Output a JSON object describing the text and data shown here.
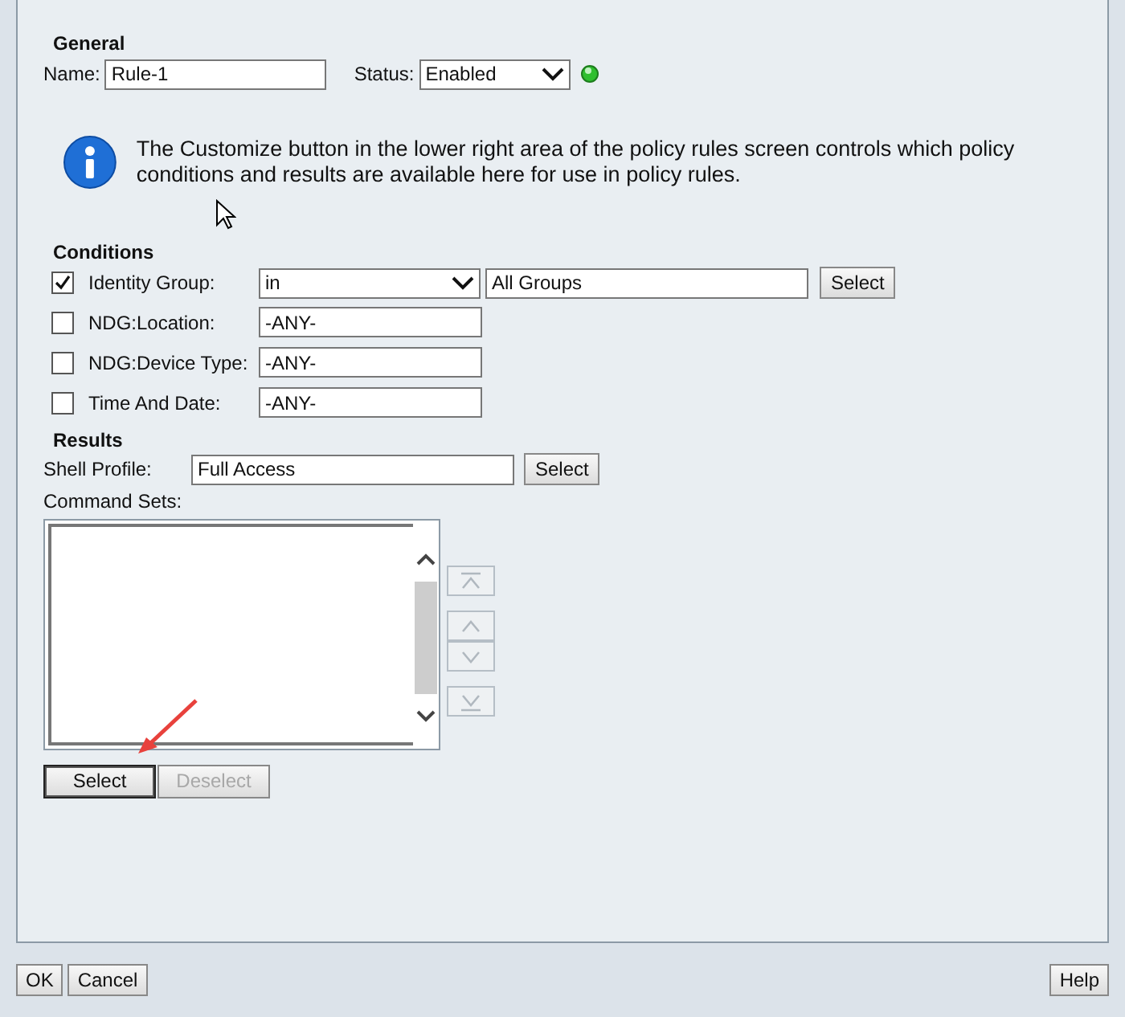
{
  "general": {
    "heading": "General",
    "name_label": "Name:",
    "name_value": "Rule-1",
    "status_label": "Status:",
    "status_value": "Enabled"
  },
  "info": {
    "text": "The Customize button in the lower right area of the policy rules screen controls which policy conditions and results are available here for use in policy rules."
  },
  "conditions": {
    "heading": "Conditions",
    "rows": [
      {
        "label": "Identity Group:",
        "checked": true,
        "kind": "select",
        "operator": "in",
        "value": "All Groups",
        "button": "Select"
      },
      {
        "label": "NDG:Location:",
        "checked": false,
        "kind": "field",
        "value": "-ANY-"
      },
      {
        "label": "NDG:Device Type:",
        "checked": false,
        "kind": "field",
        "value": "-ANY-"
      },
      {
        "label": "Time And Date:",
        "checked": false,
        "kind": "field",
        "value": "-ANY-"
      }
    ]
  },
  "results": {
    "heading": "Results",
    "shell_label": "Shell Profile:",
    "shell_value": "Full Access",
    "shell_button": "Select",
    "command_sets_label": "Command Sets:",
    "movers": [
      {
        "kind": "top",
        "disabled": true
      },
      {
        "kind": "up",
        "disabled": true
      },
      {
        "kind": "down",
        "disabled": true
      },
      {
        "kind": "bottom",
        "disabled": true
      }
    ],
    "list_buttons": [
      {
        "label": "Select",
        "disabled": false
      },
      {
        "label": "Deselect",
        "disabled": true
      }
    ]
  },
  "footer": {
    "left": [
      "OK",
      "Cancel"
    ],
    "right": [
      "Help"
    ]
  }
}
